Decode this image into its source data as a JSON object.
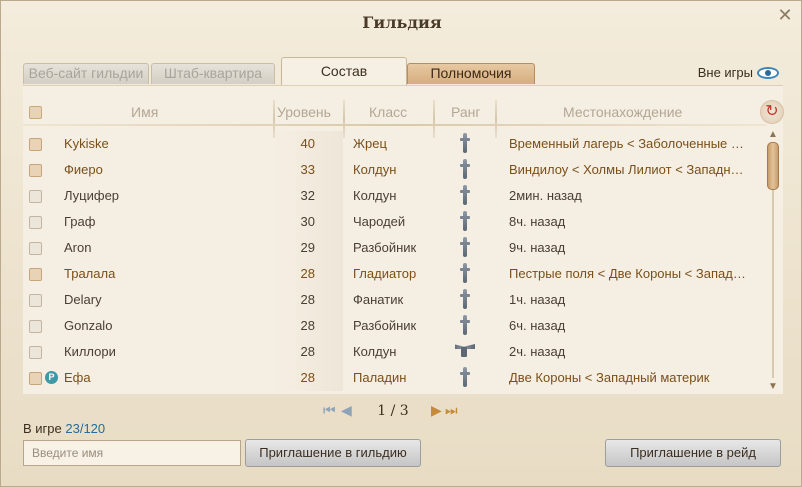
{
  "window": {
    "title": "Гильдия",
    "close_glyph": "✕"
  },
  "tabs": [
    {
      "label": "Веб-сайт гильдии",
      "state": "disabled"
    },
    {
      "label": "Штаб-квартира",
      "state": "disabled"
    },
    {
      "label": "Состав",
      "state": "active"
    },
    {
      "label": "Полномочия",
      "state": "normal"
    }
  ],
  "offline_toggle": {
    "label": "Вне игры",
    "icon": "eye-icon"
  },
  "columns": [
    "Имя",
    "Уровень",
    "Класс",
    "Ранг",
    "Местонахождение"
  ],
  "members": [
    {
      "name": "Kykiske",
      "level": "40",
      "class": "Жрец",
      "rank_icon": "rank-member-icon",
      "location": "Временный лагерь < Заболоченные ни…",
      "online": true,
      "badge": ""
    },
    {
      "name": "Фиеро",
      "level": "33",
      "class": "Колдун",
      "rank_icon": "rank-member-icon",
      "location": "Виндилоу < Холмы Лилиот < Западный …",
      "online": true,
      "badge": ""
    },
    {
      "name": "Луцифер",
      "level": "32",
      "class": "Колдун",
      "rank_icon": "rank-member-icon",
      "location": "2мин. назад",
      "online": false,
      "badge": ""
    },
    {
      "name": "Граф",
      "level": "30",
      "class": "Чародей",
      "rank_icon": "rank-member-icon",
      "location": "8ч. назад",
      "online": false,
      "badge": ""
    },
    {
      "name": "Aron",
      "level": "29",
      "class": "Разбойник",
      "rank_icon": "rank-member-icon",
      "location": "9ч. назад",
      "online": false,
      "badge": ""
    },
    {
      "name": "Тралала",
      "level": "28",
      "class": "Гладиатор",
      "rank_icon": "rank-member-icon",
      "location": "Пестрые поля < Две Короны < Западны…",
      "online": true,
      "badge": ""
    },
    {
      "name": "Delary",
      "level": "28",
      "class": "Фанатик",
      "rank_icon": "rank-member-icon",
      "location": "1ч. назад",
      "online": false,
      "badge": ""
    },
    {
      "name": "Gonzalo",
      "level": "28",
      "class": "Разбойник",
      "rank_icon": "rank-member-icon",
      "location": "6ч. назад",
      "online": false,
      "badge": ""
    },
    {
      "name": "Киллори",
      "level": "28",
      "class": "Колдун",
      "rank_icon": "rank-officer-eagle-icon",
      "location": "2ч. назад",
      "online": false,
      "badge": ""
    },
    {
      "name": "Ефа",
      "level": "28",
      "class": "Паладин",
      "rank_icon": "rank-member-icon",
      "location": "Две Короны < Западный материк",
      "online": true,
      "badge": "P"
    }
  ],
  "pagination": {
    "text": "1 / 3",
    "current": 1,
    "total": 3
  },
  "footer": {
    "ingame_label": "В игре",
    "ingame_value": "23/120",
    "name_placeholder": "Введите имя",
    "invite_guild": "Приглашение в гильдию",
    "invite_raid": "Приглашение в рейд"
  },
  "scroll": {
    "position": 0.0
  },
  "colors": {
    "online_text": "#7b4f19",
    "offline_text": "#4a3e32",
    "accent_blue": "#2b6a99",
    "active_tab_brown": "#d6ad7e"
  }
}
